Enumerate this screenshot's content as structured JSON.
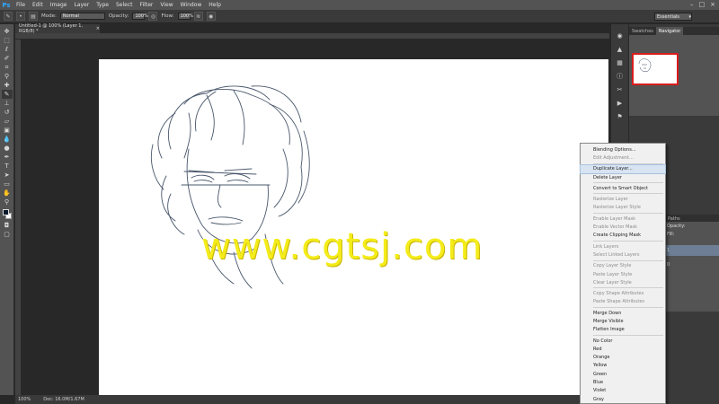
{
  "app": {
    "logo": "Ps"
  },
  "menubar": {
    "items": [
      "File",
      "Edit",
      "Image",
      "Layer",
      "Type",
      "Select",
      "Filter",
      "View",
      "Window",
      "Help"
    ],
    "controls": [
      "–",
      "□",
      "×"
    ]
  },
  "options": {
    "mode_label": "Mode:",
    "mode_value": "Normal",
    "opacity_label": "Opacity:",
    "opacity_value": "100%",
    "flow_label": "Flow:",
    "flow_value": "100%",
    "workspace": "Essentials"
  },
  "document": {
    "tab_title": "Untitled-1 @ 100% (Layer 1, RGB/8) *",
    "close": "×"
  },
  "watermark": "www.cgtsj.com",
  "status": {
    "zoom": "100%",
    "doc_size": "Doc: 16.0M/1.67M"
  },
  "panels": {
    "nav_tabs": [
      "Swatches",
      "Navigator"
    ],
    "layer_tabs": [
      "Paths"
    ],
    "layer_labels": [
      "Opacity:",
      "Fill:",
      "1",
      "0"
    ]
  },
  "context_menu": {
    "groups": [
      [
        {
          "label": "Blending Options...",
          "enabled": true
        },
        {
          "label": "Edit Adjustment...",
          "enabled": false
        }
      ],
      [
        {
          "label": "Duplicate Layer...",
          "enabled": true,
          "hover": true
        },
        {
          "label": "Delete Layer",
          "enabled": true
        }
      ],
      [
        {
          "label": "Convert to Smart Object",
          "enabled": true
        }
      ],
      [
        {
          "label": "Rasterize Layer",
          "enabled": false
        },
        {
          "label": "Rasterize Layer Style",
          "enabled": false
        }
      ],
      [
        {
          "label": "Enable Layer Mask",
          "enabled": false
        },
        {
          "label": "Enable Vector Mask",
          "enabled": false
        },
        {
          "label": "Create Clipping Mask",
          "enabled": true
        }
      ],
      [
        {
          "label": "Link Layers",
          "enabled": false
        },
        {
          "label": "Select Linked Layers",
          "enabled": false
        }
      ],
      [
        {
          "label": "Copy Layer Style",
          "enabled": false
        },
        {
          "label": "Paste Layer Style",
          "enabled": false
        },
        {
          "label": "Clear Layer Style",
          "enabled": false
        }
      ],
      [
        {
          "label": "Copy Shape Attributes",
          "enabled": false
        },
        {
          "label": "Paste Shape Attributes",
          "enabled": false
        }
      ],
      [
        {
          "label": "Merge Down",
          "enabled": true
        },
        {
          "label": "Merge Visible",
          "enabled": true
        },
        {
          "label": "Flatten Image",
          "enabled": true
        }
      ],
      [
        {
          "label": "No Color",
          "enabled": true
        },
        {
          "label": "Red",
          "enabled": true
        },
        {
          "label": "Orange",
          "enabled": true
        },
        {
          "label": "Yellow",
          "enabled": true
        },
        {
          "label": "Green",
          "enabled": true
        },
        {
          "label": "Blue",
          "enabled": true
        },
        {
          "label": "Violet",
          "enabled": true
        },
        {
          "label": "Gray",
          "enabled": true
        }
      ]
    ]
  },
  "colors": {
    "accent": "#31a8ff",
    "watermark": "#f4ec1a",
    "nav_frame": "#d81c1c",
    "foreground_swatch": "#0a1a2e"
  }
}
